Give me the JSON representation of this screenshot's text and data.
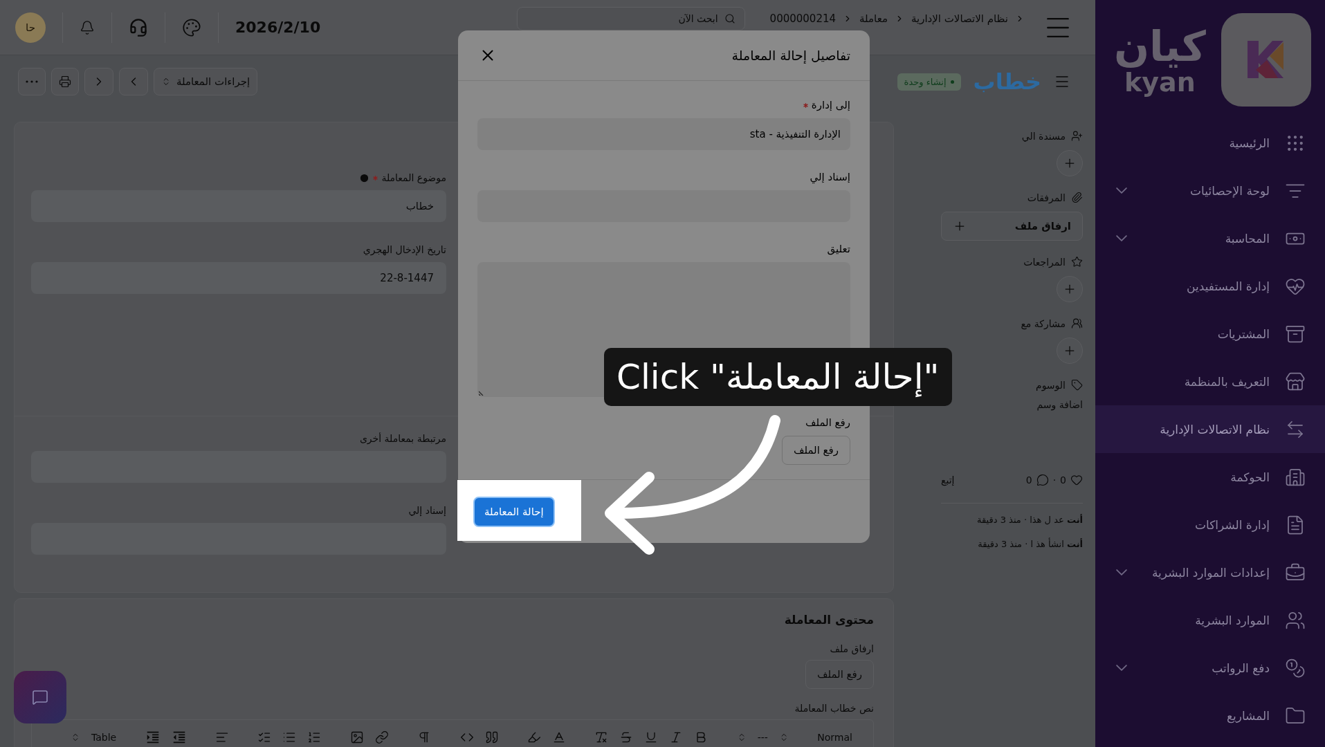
{
  "sidebar": {
    "logo": {
      "arabic": "كيان",
      "latin": "kyan"
    },
    "items": [
      {
        "label": "الرئيسية",
        "expandable": false,
        "selected": false
      },
      {
        "label": "لوحة الإحصائيات",
        "expandable": true,
        "selected": false
      },
      {
        "label": "المحاسبة",
        "expandable": true,
        "selected": false
      },
      {
        "label": "إدارة المستفيدين",
        "expandable": false,
        "selected": false
      },
      {
        "label": "المشتريات",
        "expandable": false,
        "selected": false
      },
      {
        "label": "التعريف بالمنظمة",
        "expandable": false,
        "selected": false
      },
      {
        "label": "نظام الاتصالات الإدارية",
        "expandable": false,
        "selected": true
      },
      {
        "label": "الحوكمة",
        "expandable": false,
        "selected": false
      },
      {
        "label": "إدارة الشراكات",
        "expandable": false,
        "selected": false
      },
      {
        "label": "إعدادات الموارد البشرية",
        "expandable": true,
        "selected": false
      },
      {
        "label": "الموارد البشرية",
        "expandable": false,
        "selected": false
      },
      {
        "label": "دفع الرواتب",
        "expandable": true,
        "selected": false
      },
      {
        "label": "المشاريع",
        "expandable": false,
        "selected": false
      }
    ]
  },
  "top_bar": {
    "breadcrumbs": [
      "نظام الاتصالات الإدارية",
      "معاملة",
      "0000000214"
    ],
    "search": {
      "placeholder": "ابحث الآن"
    },
    "date": "2026/2/10",
    "avatar": "حا"
  },
  "header": {
    "title": "خطاب",
    "status": "إنشاء وحدة",
    "actions_menu": "إجراءات المعاملة"
  },
  "side_panel": {
    "sections": [
      {
        "kind": "assign",
        "label": "مسندة الي"
      },
      {
        "kind": "attachments",
        "label": "المرفقات",
        "button": "ارفاق ملف"
      },
      {
        "kind": "reviews",
        "label": "المراجعات"
      },
      {
        "kind": "share",
        "label": "مشاركة مع"
      },
      {
        "kind": "tags",
        "label": "الوسوم",
        "link": "اضافة وسم"
      }
    ],
    "stats": {
      "likes": "0",
      "separator": "·",
      "comments": "0",
      "follow": "إتبع"
    },
    "activity": [
      "**أنت** عد ل هذا · منذ 3 دقيقة",
      "**أنت** انشأ هذ ا · منذ 3 دقيقة"
    ]
  },
  "form": {
    "top_fields": [
      {
        "label": "موضوع المعاملة",
        "required": true,
        "translatable": true,
        "value": "خطاب"
      },
      {
        "label": "تاريخ الإدخال الهجري",
        "required": false,
        "translatable": false,
        "value": "22-8-1447"
      }
    ],
    "bottom_fields": [
      {
        "label": "مرتبطة بمعاملة أخرى",
        "required": false,
        "translatable": false
      },
      {
        "label": "إسناد إلي",
        "required": false,
        "translatable": false
      }
    ]
  },
  "content": {
    "title": "محتوى المعاملة",
    "attach_label": "ارفاق ملف",
    "upload_button": "رفع الملف",
    "body_label": "نص خطاب المعاملة",
    "editor": {
      "block_format": "Normal",
      "font_menu": "---",
      "table_menu": "Table"
    }
  },
  "modal": {
    "title": "تفاصيل إحالة المعاملة",
    "fields": [
      {
        "kind": "select",
        "label": "إلى إدارة",
        "required": true,
        "value": "الإدارة التنفيذية - sta"
      },
      {
        "kind": "select",
        "label": "إسناد إلي",
        "required": false
      },
      {
        "kind": "textarea",
        "label": "تعليق",
        "required": false
      },
      {
        "kind": "file",
        "label": "رفع الملف",
        "required": false,
        "button": "رفع الملف"
      }
    ],
    "submit": "إحالة المعاملة"
  },
  "tutorial": {
    "callout": "Click \"إحالة المعاملة\""
  }
}
